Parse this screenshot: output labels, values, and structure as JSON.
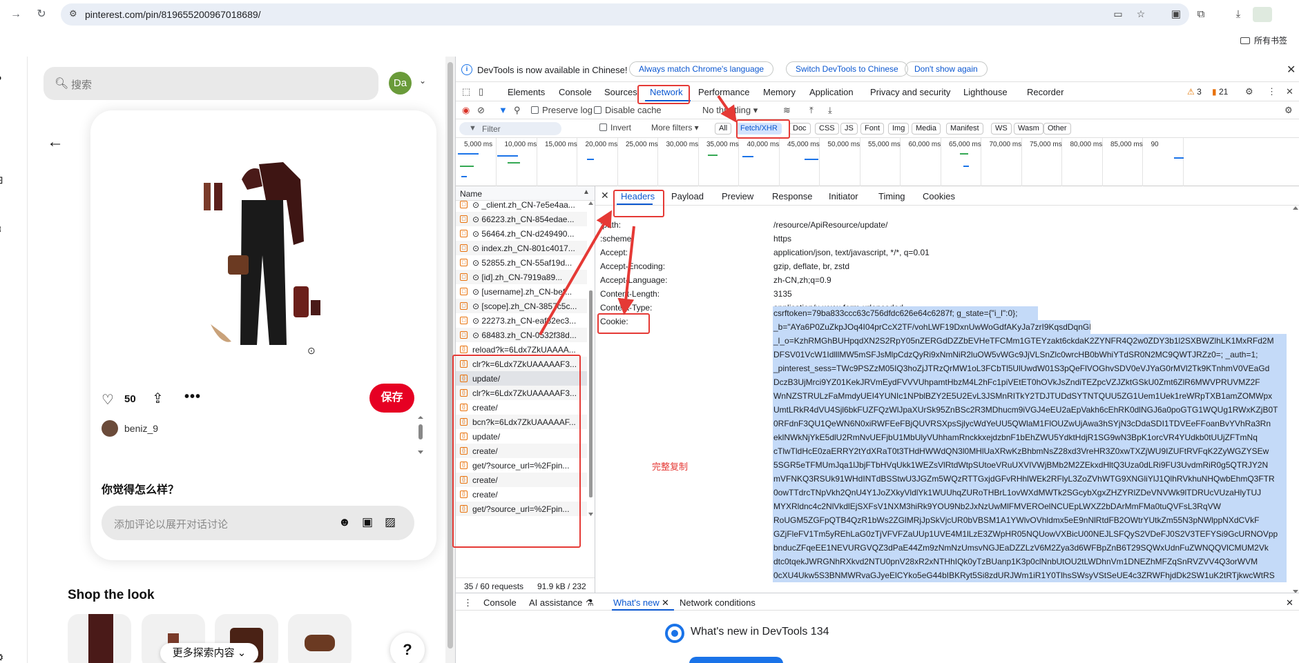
{
  "browser": {
    "url": "pinterest.com/pin/819655200967018689/",
    "bookmarks_label": "所有书签"
  },
  "pinterest": {
    "search_placeholder": "搜索",
    "avatar_initials": "Da",
    "like_count": "50",
    "save_label": "保存",
    "author": "beniz_9",
    "comment_question": "你觉得怎么样？",
    "comment_placeholder": "添加评论以展开对话讨论",
    "shop_title": "Shop the look",
    "explore_label": "更多探索内容",
    "help_label": "?"
  },
  "devtools": {
    "banner": {
      "text": "DevTools is now available in Chinese!",
      "btn_match": "Always match Chrome's language",
      "btn_switch": "Switch DevTools to Chinese",
      "btn_dont": "Don't show again"
    },
    "tabs": [
      "Elements",
      "Console",
      "Sources",
      "Network",
      "Performance",
      "Memory",
      "Application",
      "Privacy and security",
      "Lighthouse",
      "Recorder"
    ],
    "warnings": "3",
    "errors": "21",
    "toolbar": {
      "preserve_log": "Preserve log",
      "disable_cache": "Disable cache",
      "throttling": "No throttling"
    },
    "filter": {
      "placeholder": "Filter",
      "invert": "Invert",
      "more_filters": "More filters",
      "chips": [
        "All",
        "Fetch/XHR",
        "Doc",
        "CSS",
        "JS",
        "Font",
        "Img",
        "Media",
        "Manifest",
        "WS",
        "Wasm",
        "Other"
      ]
    },
    "timeline_ticks": [
      "5,000 ms",
      "10,000 ms",
      "15,000 ms",
      "20,000 ms",
      "25,000 ms",
      "30,000 ms",
      "35,000 ms",
      "40,000 ms",
      "45,000 ms",
      "50,000 ms",
      "55,000 ms",
      "60,000 ms",
      "65,000 ms",
      "70,000 ms",
      "75,000 ms",
      "80,000 ms",
      "85,000 ms",
      "90"
    ],
    "requests_header": "Name",
    "requests": [
      "⊙ _client.zh_CN-7e5e4aa...",
      "⊙ 66223.zh_CN-854edae...",
      "⊙ 56464.zh_CN-d249490...",
      "⊙ index.zh_CN-801c4017...",
      "⊙ 52855.zh_CN-55af19d...",
      "⊙ [id].zh_CN-7919a89...",
      "⊙ [username].zh_CN-bef...",
      "⊙ [scope].zh_CN-3857c5c...",
      "⊙ 22273.zh_CN-eaf32ec3...",
      "⊙ 68483.zh_CN-0532f38d...",
      "reload?k=6Ldx7ZkUAAAA...",
      "clr?k=6Ldx7ZkUAAAAAF3...",
      "update/",
      "clr?k=6Ldx7ZkUAAAAAF3...",
      "create/",
      "bcn?k=6Ldx7ZkUAAAAAF...",
      "update/",
      "create/",
      "get/?source_url=%2Fpin...",
      "create/",
      "create/",
      "get/?source_url=%2Fpin...",
      "create/",
      "get/?source_url=%2Fpin...",
      "create/"
    ],
    "footer_requests": "35 / 60 requests",
    "footer_size": "91.9 kB / 232",
    "detail_tabs": [
      "Headers",
      "Payload",
      "Preview",
      "Response",
      "Initiator",
      "Timing",
      "Cookies"
    ],
    "headers": [
      {
        "name": ":path:",
        "value": "/resource/ApiResource/update/"
      },
      {
        "name": ":scheme:",
        "value": "https"
      },
      {
        "name": "Accept:",
        "value": "application/json, text/javascript, */*, q=0.01"
      },
      {
        "name": "Accept-Encoding:",
        "value": "gzip, deflate, br, zstd"
      },
      {
        "name": "Accept-Language:",
        "value": "zh-CN,zh;q=0.9"
      },
      {
        "name": "Content-Length:",
        "value": "3135"
      },
      {
        "name": "Content-Type:",
        "value": "application/x-www-form-urlencoded"
      },
      {
        "name": "Cookie:",
        "value": ""
      }
    ],
    "cookie_lines": [
      "csrftoken=79ba833ccc63c756dfdc626e64c6287f; g_state={\"i_l\":0};",
      "_b=\"AYa6P0ZuZkpJOq4I04prCcX2TF/vohLWF19DxnUwWoGdfAKyJa7zrI9KqsdDqnGPHd8=\";",
      "_l_o=KzhRMGhBUHpqdXN2S2RpY05nZERGdDZZbEVHeTFCMm1GTEYzakt6ckdaK2ZYNFR4Q2w0ZDY3b1l2SXBWZlhLK1MxRFd2M",
      "DFSV01VcW1IdlllMW5mSFJsMlpCdzQyRi9xNmNiR2luOW5vWGc9JjVLSnZlc0wrcHB0bWhiYTdSR0N2MC9QWTJRZz0=; _auth=1;",
      "_pinterest_sess=TWc9PSZzM05IQ3hoZjJTRzQrMW1oL3FCbTl5UlUwdW01S3pQeFlVOGhvSDV0eVJYaG0rMVl2Tk9KTnhmV0VEaGd",
      "DczB3UjMrci9YZ01KekJRVmEydFVVVUhpamtHbzM4L2hFc1piVEtET0hOVkJsZndiTEZpcVZJZktGSkU0Zmt6ZlR6MWVPRUVMZ2F",
      "WnNZSTRULzFaMmdyUEI4YUNIc1NPblBZY2E5U2EvL3JSMnRITkY2TDJTUDdSYTNTQUU5ZG1Uem1Uek1reWRpTXB1amZOMWpx",
      "UmtLRkR4dVU4Sjl6bkFUZFQzWlJpaXUrSk95ZnBSc2R3MDhucm9iVGJ4eEU2aEpVakh6cEhRK0dlNGJ6a0poGTG1WQUg1RWxKZjB0T",
      "0RFdnF3QU1QeWN6N0xiRWFEeFBjQUVRSXpsSjlycWdYeUU5QWlaM1FlOUZwUjAwa3hSYjN3cDdaSDI1TDVEeFFoanBvYVhRa3Rn",
      "eklNWkNjYkE5dlU2RmNvUEFjbU1MbUlyVUhhamRnckkxejdzbnF1bEhZWU5YdktHdjR1SG9wN3BpK1orcVR4YUdkb0tUUjZFTmNq",
      "cTlwTldHcE0zaERRY2tYdXRaT0t3THdHWWdQN3l0MHlUaXRwKzBhbmNsZ28xd3VreHR3Z0xwTXZjWU9IZUFtRVFqK2ZyWGZYSEw",
      "5SGR5eTFMUmJqa1lJbjFTbHVqUkk1WEZsVlRtdWtpSUtoeVRuUXVIVWjBMb2M2ZEkxdHltQ3Uza0dLRi9FU3UvdmRiR0g5QTRJY2N",
      "mVFNKQ3RSUk91WHdINTdBSStwU3JGZm5WQzRTTGxjdGFvRHhlWEk2RFlyL3ZoZVhWTG9XNGliYlJ1QlhRVkhuNHQwbEhmQ3FTR",
      "0owTTdrcTNpVkh2QnU4Y1JoZXkyVldlYk1WUUhqZURoTHBrL1ovWXdMWTk2SGcybXgxZHZYRlZDeVNVWk9lTDRUcVUzaHlyTUJ",
      "MYXRldnc4c2NlVkdlEjSXFsV1NXM3hiRk9YOU9Nb2JxNzUwMlFMVEROelNCUEpLWXZ2bDArMmFMa0tuQVFsL3RqVW",
      "RoUGM5ZGFpQTB4QzR1bWs2ZGlMRjJpSkVjcUR0bVBSM1A1YWlvOVhldmx5eE9nNlRtdFB2OWtrYUtkZm55N3pNWlppNXdCVkF",
      "GZjFleFV1Tm5yREhLaG0zTjVFVFZaUUp1UVE4M1lLzE3ZWpHR05NQUowVXBicU00NEJLSFQyS2VDeFJ0S2V3TEFYSi9GcURNOVpp",
      "bnducZFqeEE1NEVURGVQZ3dPaE44Zm9zNmNzUmsvNGJEaDZZLzV6M2Zya3d6WFBpZnB6T29SQWxUdnFuZWNQQVlCMUM2Vk",
      "dtc0tqekJWRGNhRXkvd2NTU0pnV28xR2xNTHhIQk0yTzBUanp1K3p0clNnbUtOU2tLWDhnVm1DNEZhMFZqSnRVZVV4Q3orWVM",
      "0cXU4Ukw5S3BNMWRvaGJyeElCYko5eG44bIBKRyt5Si8zdURJWm1iR1Y0TlhsSWsyVStSeUE4c3ZRWFhjdDk2SW1uK2tRTjkwcWtRS"
    ],
    "annotation": "完整复制",
    "drawer_tabs": [
      "Console",
      "AI assistance",
      "What's new",
      "Network conditions"
    ],
    "whats_new": "What's new in DevTools 134"
  }
}
